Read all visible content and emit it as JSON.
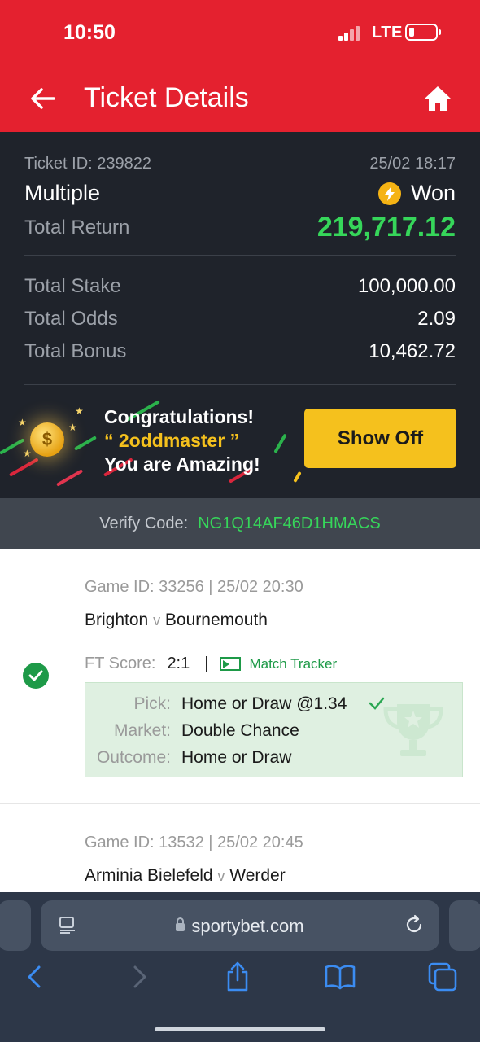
{
  "status_bar": {
    "time": "10:50",
    "network": "LTE"
  },
  "header": {
    "title": "Ticket Details"
  },
  "ticket": {
    "id_label": "Ticket ID: 239822",
    "datetime": "25/02 18:17",
    "type": "Multiple",
    "status": "Won",
    "total_return_label": "Total Return",
    "total_return": "219,717.12",
    "stats": [
      {
        "label": "Total Stake",
        "value": "100,000.00"
      },
      {
        "label": "Total Odds",
        "value": "2.09"
      },
      {
        "label": "Total Bonus",
        "value": "10,462.72"
      }
    ]
  },
  "promo": {
    "line1": "Congratulations!",
    "line2_prefix": "“ ",
    "username": "2oddmaster",
    "line2_suffix": " ”",
    "line3": "You are Amazing!",
    "button": "Show Off",
    "coin_symbol": "$"
  },
  "verify": {
    "label": "Verify Code:",
    "code": "NG1Q14AF46D1HMACS"
  },
  "games": [
    {
      "id_line": "Game ID: 33256 | 25/02 20:30",
      "home": "Brighton",
      "vs": "v",
      "away": "Bournemouth",
      "ft_label": "FT Score:",
      "score": "2:1",
      "separator": "|",
      "tracker": "Match Tracker",
      "pick_label": "Pick:",
      "pick": "Home or Draw @1.34",
      "market_label": "Market:",
      "market": "Double Chance",
      "outcome_label": "Outcome:",
      "outcome": "Home or Draw"
    },
    {
      "id_line": "Game ID: 13532 | 25/02 20:45",
      "home": "Arminia Bielefeld",
      "vs": "v",
      "away": "Werder"
    }
  ],
  "browser": {
    "url": "sportybet.com"
  },
  "colors": {
    "brand_red": "#e4212f",
    "won_green": "#36d65a",
    "accent_yellow": "#f5c11d",
    "dark_panel": "#1f232b"
  }
}
